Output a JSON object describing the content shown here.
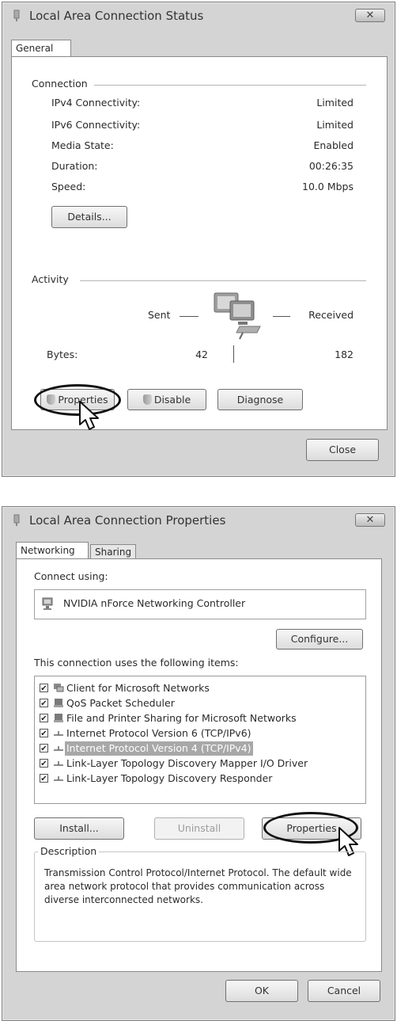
{
  "status_dialog": {
    "title": "Local Area Connection Status",
    "close_glyph": "✕",
    "tab": "General",
    "connection_group": "Connection",
    "rows": [
      {
        "label": "IPv4 Connectivity:",
        "value": "Limited"
      },
      {
        "label": "IPv6 Connectivity:",
        "value": "Limited"
      },
      {
        "label": "Media State:",
        "value": "Enabled"
      },
      {
        "label": "Duration:",
        "value": "00:26:35"
      },
      {
        "label": "Speed:",
        "value": "10.0 Mbps"
      }
    ],
    "details_button": "Details...",
    "activity_group": "Activity",
    "sent_label": "Sent",
    "received_label": "Received",
    "bytes_label": "Bytes:",
    "bytes_sent": "42",
    "bytes_received": "182",
    "properties_button": "Properties",
    "disable_button": "Disable",
    "diagnose_button": "Diagnose",
    "close_button": "Close"
  },
  "properties_dialog": {
    "title": "Local Area Connection Properties",
    "close_glyph": "✕",
    "tabs": [
      "Networking",
      "Sharing"
    ],
    "connect_using_label": "Connect using:",
    "adapter_name": "NVIDIA nForce Networking Controller",
    "configure_button": "Configure...",
    "items_label": "This connection uses the following items:",
    "items": [
      {
        "label": "Client for Microsoft Networks",
        "checked": true,
        "icon": "network-client-icon"
      },
      {
        "label": "QoS Packet Scheduler",
        "checked": true,
        "icon": "service-icon"
      },
      {
        "label": "File and Printer Sharing for Microsoft Networks",
        "checked": true,
        "icon": "service-icon"
      },
      {
        "label": "Internet Protocol Version 6 (TCP/IPv6)",
        "checked": true,
        "icon": "protocol-icon"
      },
      {
        "label": "Internet Protocol Version 4 (TCP/IPv4)",
        "checked": true,
        "icon": "protocol-icon",
        "selected": true
      },
      {
        "label": "Link-Layer Topology Discovery Mapper I/O Driver",
        "checked": true,
        "icon": "protocol-icon"
      },
      {
        "label": "Link-Layer Topology Discovery Responder",
        "checked": true,
        "icon": "protocol-icon"
      }
    ],
    "install_button": "Install...",
    "uninstall_button": "Uninstall",
    "properties_button": "Properties",
    "description_group": "Description",
    "description_text": "Transmission Control Protocol/Internet Protocol. The default wide area network protocol that provides communication across diverse interconnected networks.",
    "ok_button": "OK",
    "cancel_button": "Cancel"
  },
  "colors": {
    "dialog_bg": "#d4d4d4",
    "panel_bg": "#ffffff",
    "selection_bg": "#a8a8a8",
    "highlight_ellipse": "#111111"
  }
}
